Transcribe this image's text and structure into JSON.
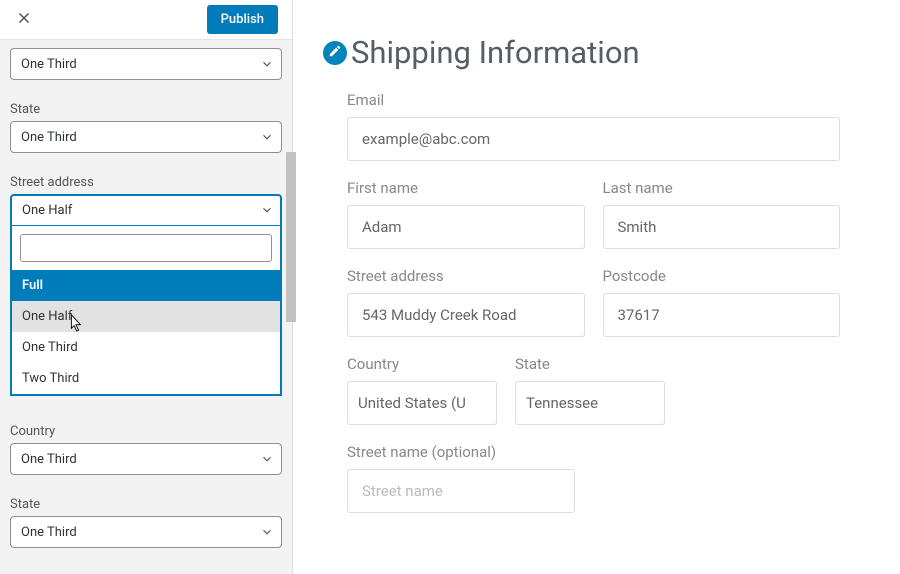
{
  "header": {
    "publish": "Publish"
  },
  "sidebar": {
    "field0": {
      "value": "One Third"
    },
    "state_label": "State",
    "field_state": {
      "value": "One Third"
    },
    "street_label": "Street address",
    "field_street": {
      "value": "One Half"
    },
    "dropdown": {
      "opt_full": "Full",
      "opt_half": "One Half",
      "opt_third": "One Third",
      "opt_twothird": "Two Third"
    },
    "country_label": "Country",
    "field_country": {
      "value": "One Third"
    },
    "state2_label": "State",
    "field_state2": {
      "value": "One Third"
    }
  },
  "preview": {
    "title": "Shipping Information",
    "email_label": "Email",
    "email_value": "example@abc.com",
    "first_label": "First name",
    "first_value": "Adam",
    "last_label": "Last name",
    "last_value": "Smith",
    "street_label": "Street address",
    "street_value": "543 Muddy Creek Road",
    "postcode_label": "Postcode",
    "postcode_value": "37617",
    "country_label": "Country",
    "country_value": "United States (U",
    "state_label": "State",
    "state_value": "Tennessee",
    "streetname_label": "Street name (optional)",
    "streetname_placeholder": "Street name"
  }
}
